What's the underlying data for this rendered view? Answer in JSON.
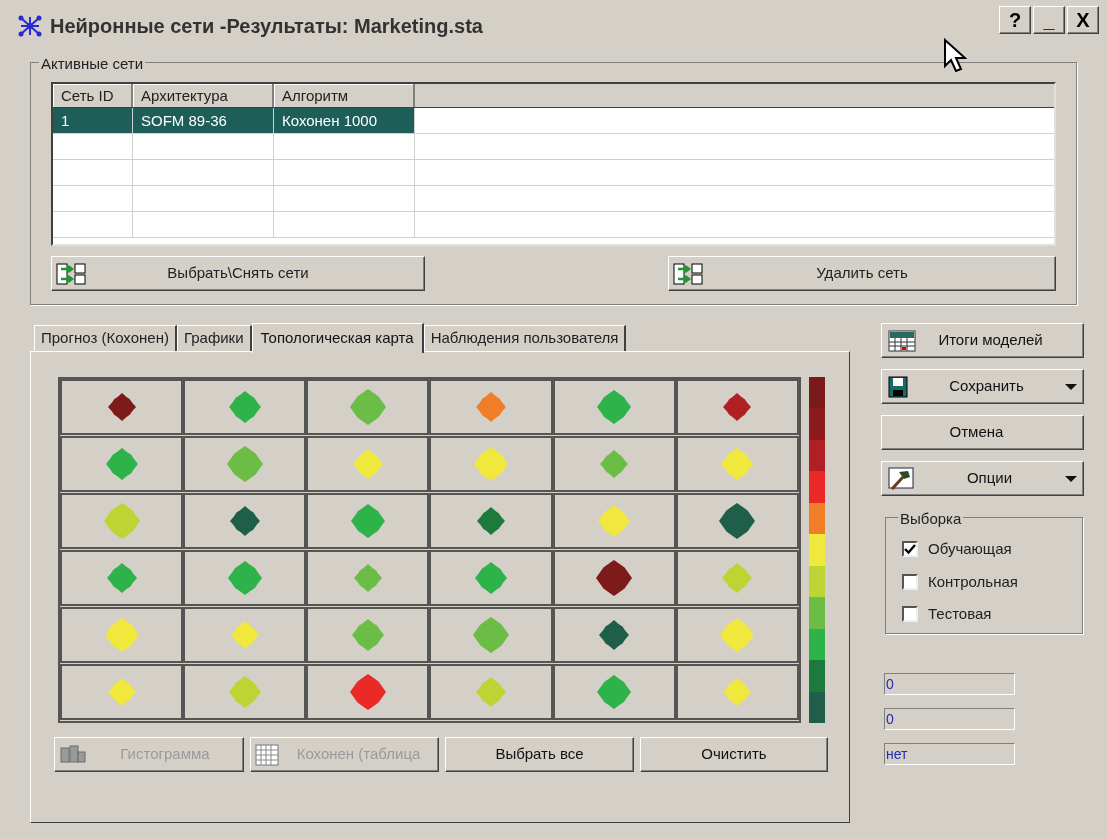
{
  "window": {
    "title": "Нейронные сети -Результаты: Marketing.sta",
    "controls": [
      "?",
      "_",
      "X"
    ]
  },
  "active_networks": {
    "label": "Активные сети",
    "columns": [
      "Сеть ID",
      "Архитектура",
      "Алгоритм"
    ],
    "rows": [
      {
        "cells": [
          "1",
          "SOFM 89-36",
          "Кохонен 1000"
        ],
        "selected": true
      }
    ],
    "buttons": [
      {
        "label": "Выбрать\\Снять сети"
      },
      {
        "label": "Удалить сеть"
      }
    ]
  },
  "tabs": [
    {
      "label": "Прогноз (Кохонен)",
      "selected": false
    },
    {
      "label": "Графики",
      "selected": false
    },
    {
      "label": "Топологическая карта",
      "selected": true
    },
    {
      "label": "Наблюдения пользователя",
      "selected": false
    }
  ],
  "topological_map": {
    "cells": [
      [
        {
          "color": "#7d1a1a"
        },
        {
          "color": "#2db34a"
        },
        {
          "color": "#6bbd45"
        },
        {
          "color": "#f07d28"
        },
        {
          "color": "#2db34a"
        },
        {
          "color": "#b01f24"
        }
      ],
      [
        {
          "color": "#2db34a"
        },
        {
          "color": "#6bbd45"
        },
        {
          "color": "#f0e83c"
        },
        {
          "color": "#f0e83c"
        },
        {
          "color": "#6bbd45"
        },
        {
          "color": "#f0e83c"
        }
      ],
      [
        {
          "color": "#bcd535"
        },
        {
          "color": "#1f5e48"
        },
        {
          "color": "#2db34a"
        },
        {
          "color": "#1b7a3c"
        },
        {
          "color": "#f0e83c"
        },
        {
          "color": "#1f5e48"
        }
      ],
      [
        {
          "color": "#2db34a"
        },
        {
          "color": "#2db34a"
        },
        {
          "color": "#6bbd45"
        },
        {
          "color": "#2db34a"
        },
        {
          "color": "#7d1a1a"
        },
        {
          "color": "#bcd535"
        }
      ],
      [
        {
          "color": "#f0e83c"
        },
        {
          "color": "#f0e83c"
        },
        {
          "color": "#6bbd45"
        },
        {
          "color": "#6bbd45"
        },
        {
          "color": "#1f5e48"
        },
        {
          "color": "#f0e83c"
        }
      ],
      [
        {
          "color": "#f0e83c"
        },
        {
          "color": "#bcd535"
        },
        {
          "color": "#e92a27"
        },
        {
          "color": "#bcd535"
        },
        {
          "color": "#2db34a"
        },
        {
          "color": "#f0e83c"
        }
      ]
    ],
    "scale": [
      {
        "color": "#7a1a1a"
      },
      {
        "color": "#8b1a1d"
      },
      {
        "color": "#b01f24"
      },
      {
        "color": "#e92a27"
      },
      {
        "color": "#f07d28"
      },
      {
        "color": "#f0e83c"
      },
      {
        "color": "#bcd535"
      },
      {
        "color": "#6bbd45"
      },
      {
        "color": "#2db34a"
      },
      {
        "color": "#1b7a3c"
      },
      {
        "color": "#1f5e48"
      }
    ]
  },
  "map_buttons": [
    {
      "label": "Гистограмма",
      "disabled": true,
      "kind": "histogram"
    },
    {
      "label": "Кохонен (таблица",
      "disabled": true,
      "kind": "table"
    },
    {
      "label": "Выбрать все",
      "disabled": false,
      "kind": "plain"
    },
    {
      "label": "Очистить",
      "disabled": false,
      "kind": "plain"
    }
  ],
  "side_buttons": [
    {
      "label": "Итоги моделей",
      "kind": "summary",
      "dropdown": false
    },
    {
      "label": "Сохранить",
      "kind": "save",
      "dropdown": true
    },
    {
      "label": "Отмена",
      "kind": "plain",
      "dropdown": false
    },
    {
      "label": "Опции",
      "kind": "options",
      "dropdown": true
    }
  ],
  "sample": {
    "label": "Выборка",
    "options": [
      {
        "label": "Обучающая",
        "checked": true
      },
      {
        "label": "Контрольная",
        "checked": false
      },
      {
        "label": "Тестовая",
        "checked": false
      }
    ]
  },
  "fields": [
    {
      "value": "0"
    },
    {
      "value": "0"
    },
    {
      "value": "нет"
    }
  ]
}
